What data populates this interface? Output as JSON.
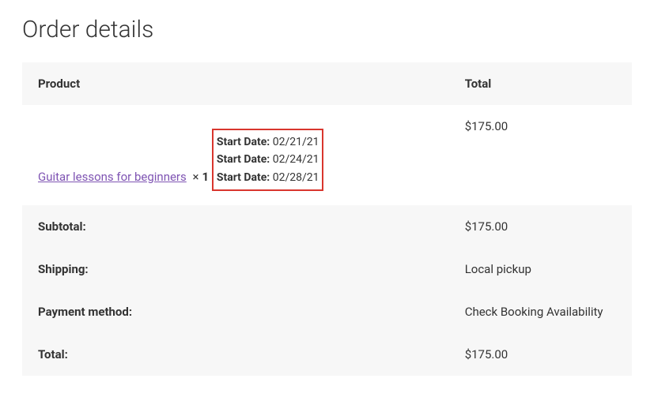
{
  "page": {
    "title": "Order details"
  },
  "table": {
    "headers": {
      "product": "Product",
      "total": "Total"
    },
    "product": {
      "name": "Guitar lessons for beginners",
      "qty_separator": "×",
      "qty": "1",
      "total": "$175.00",
      "dates": [
        {
          "label": "Start Date:",
          "value": "02/21/21"
        },
        {
          "label": "Start Date:",
          "value": "02/24/21"
        },
        {
          "label": "Start Date:",
          "value": "02/28/21"
        }
      ]
    },
    "summary": {
      "subtotal_label": "Subtotal:",
      "subtotal_value": "$175.00",
      "shipping_label": "Shipping:",
      "shipping_value": "Local pickup",
      "payment_label": "Payment method:",
      "payment_value": "Check Booking Availability",
      "total_label": "Total:",
      "total_value": "$175.00"
    }
  }
}
